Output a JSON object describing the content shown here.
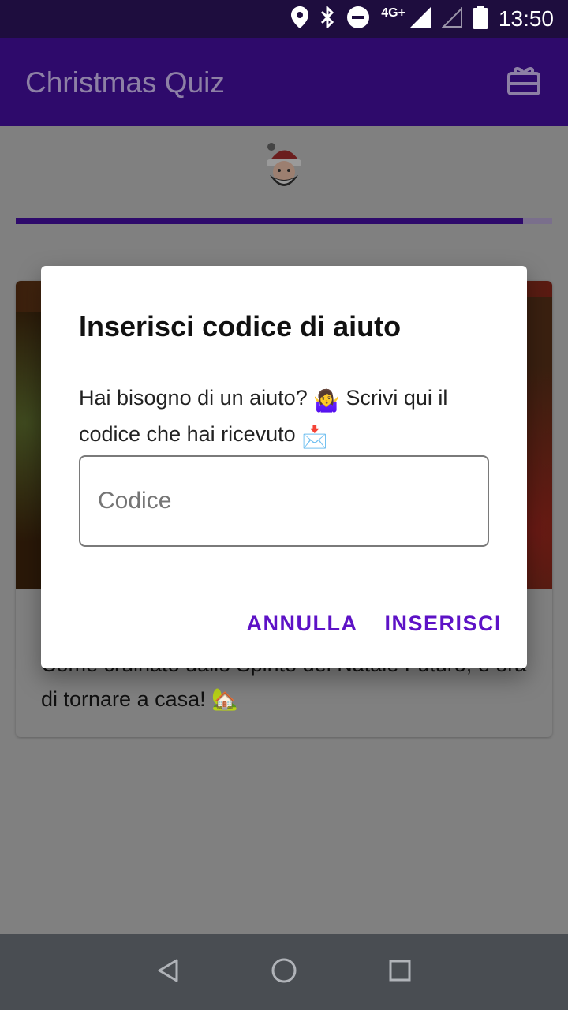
{
  "status_bar": {
    "time": "13:50",
    "network": "4G+",
    "icons": [
      "location-icon",
      "bluetooth-icon",
      "do-not-disturb-icon",
      "signal-icon",
      "signal-empty-icon",
      "battery-icon"
    ]
  },
  "app_bar": {
    "title": "Christmas Quiz",
    "action_icon": "gift-card-icon"
  },
  "quiz": {
    "progress": 0.945
  },
  "card": {
    "text": "Come cruinato dallo Spirito del Natale Futuro, è ora di tornare a casa! 🏡"
  },
  "dialog": {
    "title": "Inserisci codice di aiuto",
    "message_part1": "Hai bisogno di un aiuto?",
    "message_emoji1": "🤷‍♀️",
    "message_part2": "Scrivi qui il codice che hai ricevuto",
    "message_emoji2": "📩",
    "input_placeholder": "Codice",
    "input_value": "",
    "cancel_label": "ANNULLA",
    "confirm_label": "INSERISCI"
  },
  "colors": {
    "status_bar": "#1e0d3e",
    "app_bar": "#2e0a6b",
    "accent": "#5d12c6",
    "nav_bar": "#494d52",
    "scrim": "#808080"
  },
  "nav_bar": {
    "icons": [
      "back-icon",
      "home-icon",
      "recents-icon"
    ]
  }
}
